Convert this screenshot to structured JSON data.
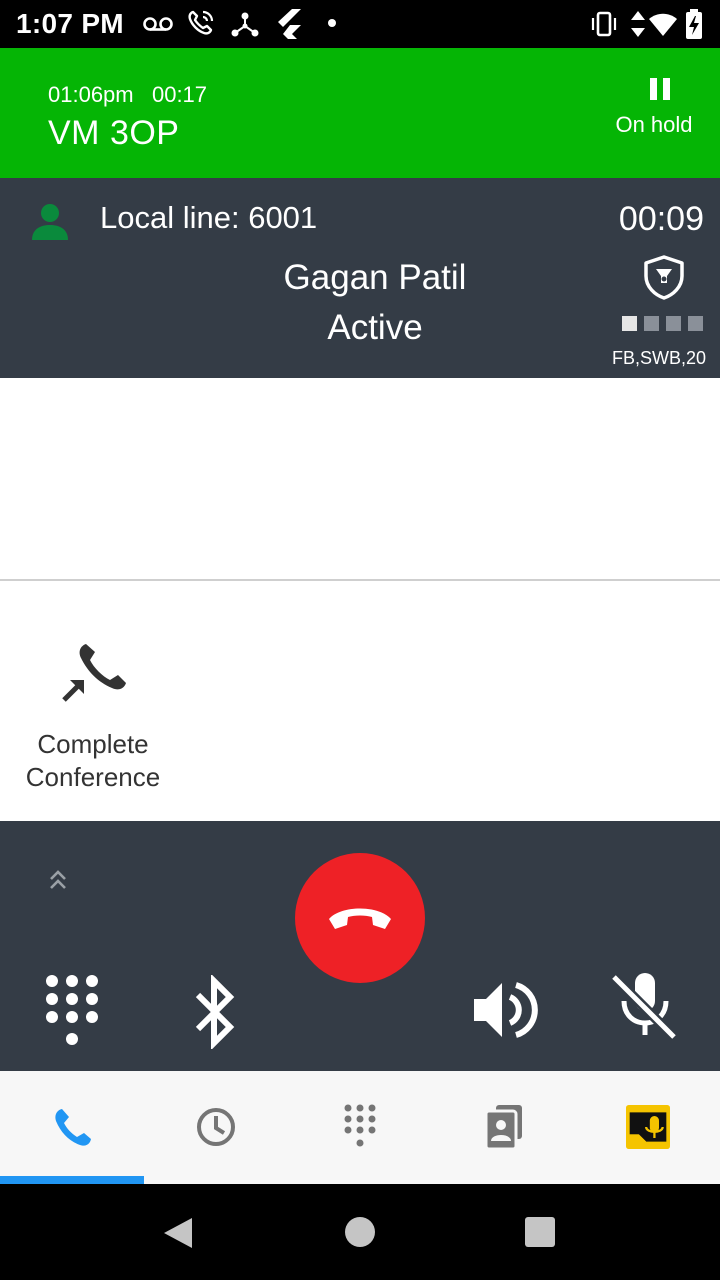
{
  "status_bar": {
    "time": "1:07 PM",
    "left_icons": [
      "voicemail-icon",
      "wifi-calling-icon",
      "hub-icon",
      "flutter-icon",
      "dot-icon"
    ],
    "right_icons": [
      "vibrate-icon",
      "data-arrows-icon",
      "wifi-icon",
      "battery-charging-icon"
    ]
  },
  "held_call": {
    "start_time": "01:06pm",
    "duration": "00:17",
    "name": "VM 3OP",
    "status": "On hold",
    "background": "#05b505"
  },
  "active_call": {
    "line_label": "Local line: 6001",
    "timer": "00:09",
    "caller": "Gagan Patil",
    "state": "Active",
    "codec": "FB,SWB,20",
    "quality_level": 1,
    "quality_max": 4,
    "background": "#343c46"
  },
  "actions": {
    "complete_conference_label": "Complete Conference"
  },
  "controls": {
    "hangup_color": "#ee2126",
    "buttons": [
      "expand-icon",
      "dialpad-icon",
      "bluetooth-icon",
      "hangup-icon",
      "speaker-icon",
      "mute-icon"
    ]
  },
  "bottom_nav": {
    "tabs": [
      "calls-icon",
      "history-icon",
      "dialpad-icon",
      "contacts-icon",
      "voicemail-app-icon"
    ],
    "active_tab": 0,
    "accent": "#2196f3"
  }
}
